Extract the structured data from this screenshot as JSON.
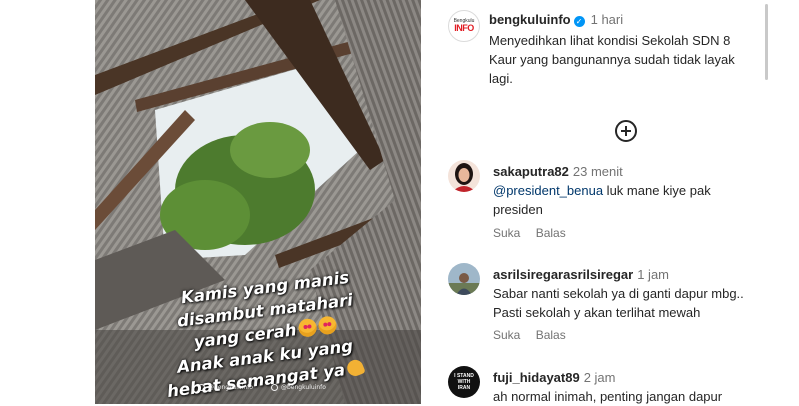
{
  "post": {
    "logo_top": "Bengkulu",
    "logo_bottom": "INFO",
    "username": "bengkuluinfo",
    "time": "1 hari",
    "caption": "Menyedihkan lihat kondisi Sekolah SDN 8 Kaur yang bangunannya sudah tidak layak lagi."
  },
  "media": {
    "overlay_lines": [
      "Kamis yang manis",
      "disambut matahari",
      "yang cerah",
      "Anak anak ku yang",
      "hebat semangat ya"
    ],
    "watermark_1": "@bengkuluinfo",
    "watermark_2": "@bengkuluinfo"
  },
  "comments": [
    {
      "username": "sakaputra82",
      "time": "23 menit",
      "mention": "@president_benua",
      "text": " luk mane kiye pak presiden",
      "reply_label": "Suka",
      "balas_label": "Balas"
    },
    {
      "username": "asrilsiregarasrilsiregar",
      "time": "1 jam",
      "text": "Sabar nanti sekolah ya di ganti dapur mbg.. Pasti sekolah y akan terlihat mewah",
      "reply_label": "Suka",
      "balas_label": "Balas"
    },
    {
      "username": "fuji_hidayat89",
      "time": "2 jam",
      "text": "ah normal inimah, penting jangan dapur",
      "avatar_text": "I STAND WITH IRAN"
    }
  ]
}
